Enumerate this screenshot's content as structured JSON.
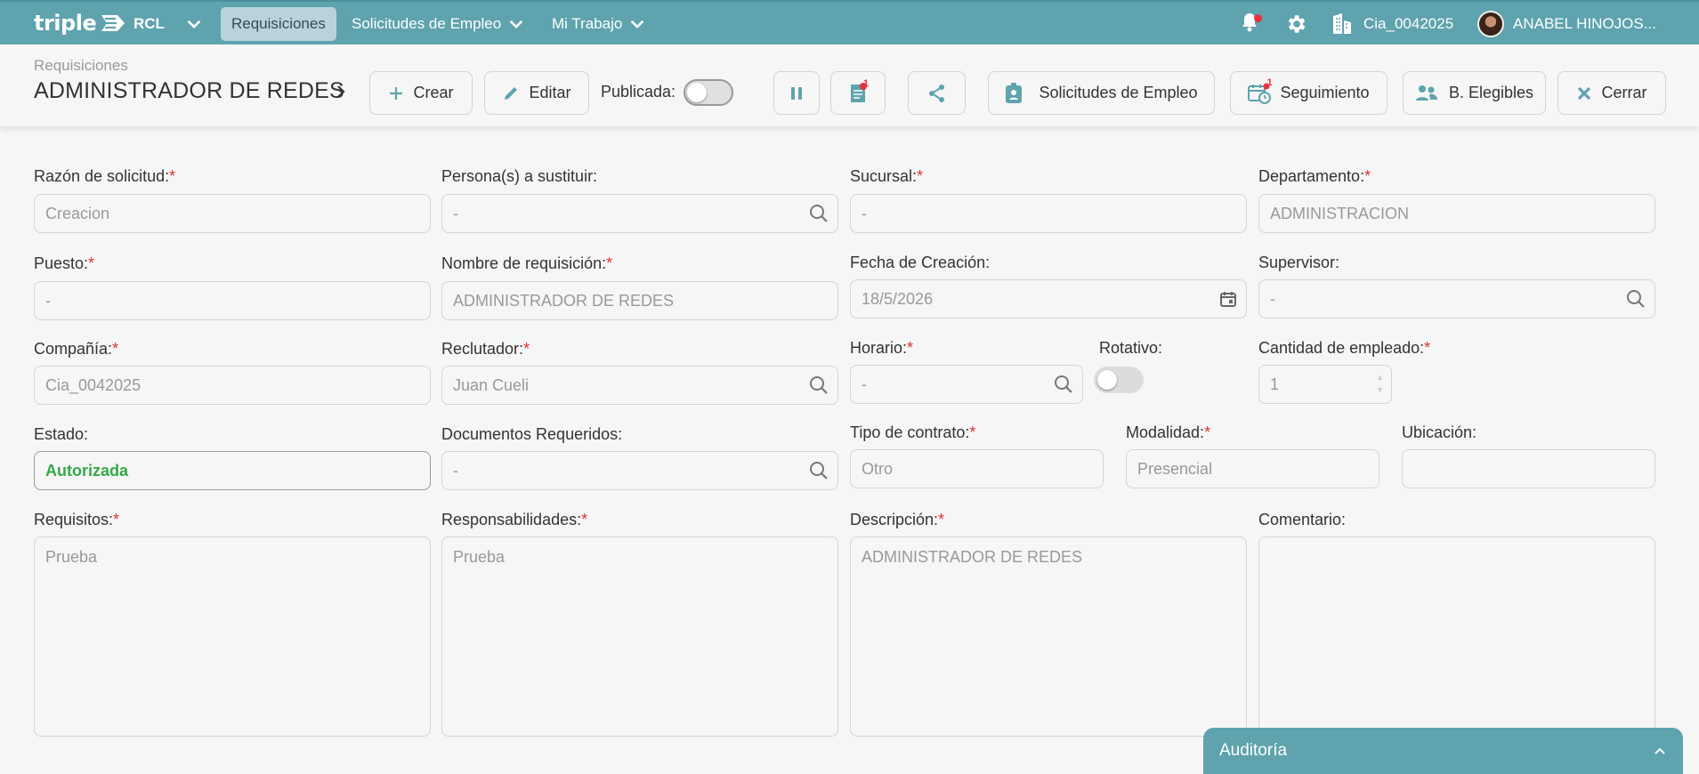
{
  "nav": {
    "logo": "triple",
    "company_short": "RCL",
    "items": [
      {
        "label": "Requisiciones",
        "active": true
      },
      {
        "label": "Solicitudes de Empleo"
      },
      {
        "label": "Mi Trabajo"
      }
    ],
    "company": "Cia_0042025",
    "user": "ANABEL HINOJOS..."
  },
  "header": {
    "breadcrumb": "Requisiciones",
    "title": "ADMINISTRADOR DE REDES",
    "buttons": {
      "create": "Crear",
      "edit": "Editar",
      "published": "Publicada:",
      "notes_badge": "1",
      "tracking_badge": "1",
      "applications": "Solicitudes de Empleo",
      "tracking": "Seguimiento",
      "eligible": "B. Elegibles",
      "close": "Cerrar"
    },
    "published_on": false
  },
  "form": {
    "razon": {
      "label": "Razón de solicitud:",
      "value": "Creacion"
    },
    "persona": {
      "label": "Persona(s) a sustituir:",
      "value": "-"
    },
    "sucursal": {
      "label": "Sucursal:",
      "value": "-"
    },
    "departamento": {
      "label": "Departamento:",
      "value": "ADMINISTRACION"
    },
    "puesto": {
      "label": "Puesto:",
      "value": "-"
    },
    "nombre": {
      "label": "Nombre de requisición:",
      "value": "ADMINISTRADOR DE REDES"
    },
    "fecha": {
      "label": "Fecha de Creación:",
      "value": "18/5/2026"
    },
    "supervisor": {
      "label": "Supervisor:",
      "value": "-"
    },
    "compania": {
      "label": "Compañía:",
      "value": "Cia_0042025"
    },
    "reclutador": {
      "label": "Reclutador:",
      "value": "Juan Cueli"
    },
    "horario": {
      "label": "Horario:",
      "value": "-"
    },
    "rotativo": {
      "label": "Rotativo:",
      "on": false
    },
    "cantidad": {
      "label": "Cantidad de empleado:",
      "value": "1"
    },
    "estado": {
      "label": "Estado:",
      "value": "Autorizada"
    },
    "documentos": {
      "label": "Documentos Requeridos:",
      "value": "-"
    },
    "tipo": {
      "label": "Tipo de contrato:",
      "value": "Otro"
    },
    "modalidad": {
      "label": "Modalidad:",
      "value": "Presencial"
    },
    "ubicacion": {
      "label": "Ubicación:",
      "value": ""
    },
    "requisitos": {
      "label": "Requisitos:",
      "value": "Prueba"
    },
    "responsabilidades": {
      "label": "Responsabilidades:",
      "value": "Prueba"
    },
    "descripcion": {
      "label": "Descripción:",
      "value": "ADMINISTRADOR DE REDES"
    },
    "comentario": {
      "label": "Comentario:",
      "value": ""
    }
  },
  "audit": {
    "label": "Auditoría"
  },
  "colors": {
    "primary": "#5ea3ae",
    "required": "#dd3333",
    "status_green": "#33a84a",
    "notify_red": "#e8323b"
  }
}
